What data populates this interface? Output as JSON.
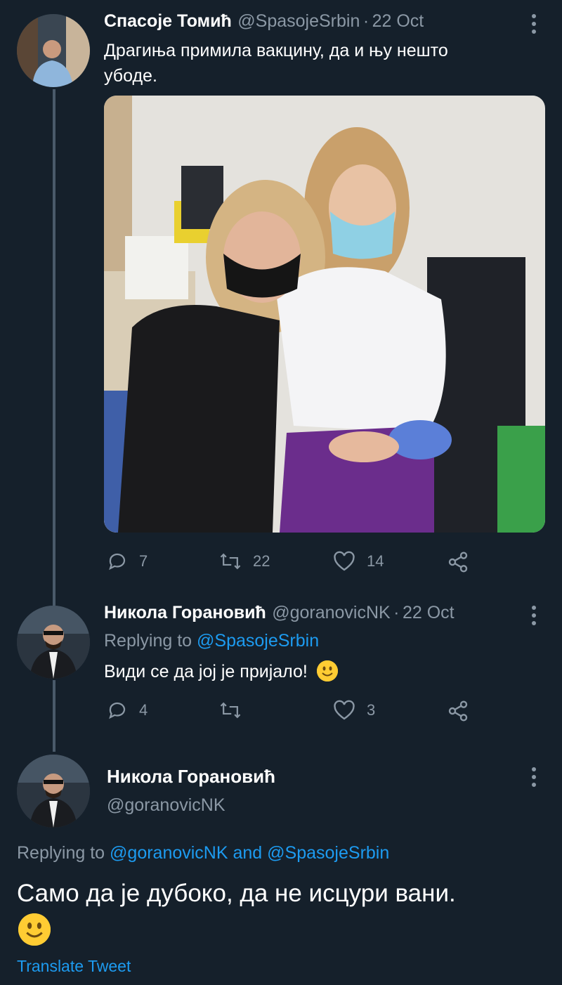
{
  "tweet1": {
    "author_name": "Спасоје Томић",
    "handle": "@SpasojeSrbin",
    "separator": "·",
    "date": "22 Oct",
    "text_line1": "Драгиња примила вакцину, да и њу нешто",
    "text_line2": "убоде.",
    "actions": {
      "reply_count": "7",
      "retweet_count": "22",
      "like_count": "14"
    }
  },
  "tweet2": {
    "author_name": "Никола Горановић",
    "handle": "@goranovicNK",
    "separator": "·",
    "date": "22 Oct",
    "replying_prefix": "Replying to",
    "replying_to": "@SpasojeSrbin",
    "text": "Види се да јој је пријало!",
    "actions": {
      "reply_count": "4",
      "retweet_count": "",
      "like_count": "3"
    }
  },
  "tweet3": {
    "author_name": "Никола Горановић",
    "handle": "@goranovicNK",
    "replying_prefix": "Replying to",
    "replying_to_1": "@goranovicNK",
    "replying_and": "and",
    "replying_to_2": "@SpasojeSrbin",
    "text": "Само да је дубоко, да не исцури вани.",
    "translate_label": "Translate Tweet"
  },
  "icons": [
    "more-icon",
    "reply-icon",
    "retweet-icon",
    "like-icon",
    "share-icon",
    "smiley-emoji"
  ],
  "colors": {
    "background": "#15202b",
    "link": "#1d9bf0",
    "muted": "#8b98a5",
    "thread_line": "#4a5a6a"
  }
}
